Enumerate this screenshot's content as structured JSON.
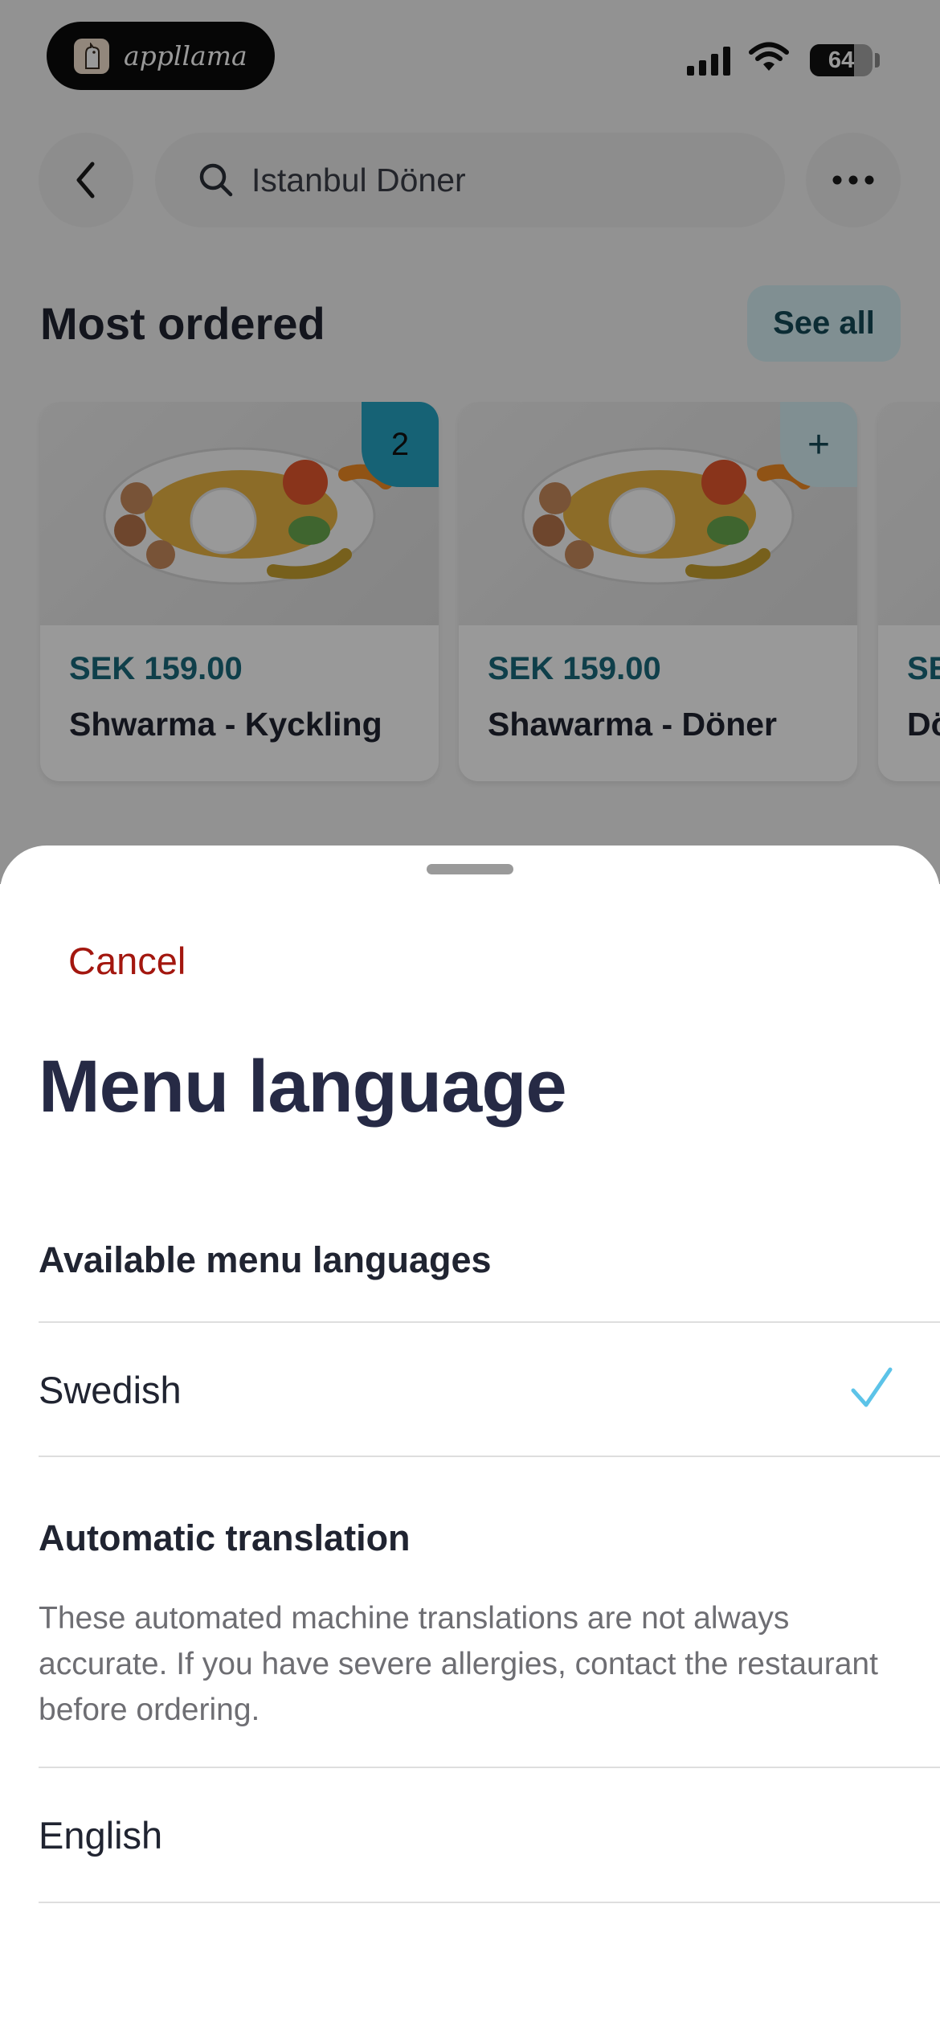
{
  "app_pill": {
    "name": "appllama"
  },
  "status": {
    "battery": "64"
  },
  "search": {
    "text": "Istanbul Döner"
  },
  "most_ordered": {
    "title": "Most ordered",
    "see_all": "See all",
    "cards": [
      {
        "price": "SEK 159.00",
        "name": "Shwarma - Kyckling",
        "badge": "2"
      },
      {
        "price": "SEK 159.00",
        "name": "Shawarma - Döner",
        "badge": "+"
      },
      {
        "price": "SE",
        "name": "Dö"
      }
    ]
  },
  "sheet": {
    "cancel": "Cancel",
    "title": "Menu language",
    "available_label": "Available menu languages",
    "languages": [
      {
        "label": "Swedish",
        "selected": true
      }
    ],
    "auto_label": "Automatic translation",
    "auto_note": "These automated machine translations are not always accurate. If you have severe allergies, contact the restaurant before ordering.",
    "auto_languages": [
      {
        "label": "English"
      }
    ]
  },
  "colors": {
    "accent": "#26a3c4",
    "cancel": "#a3170f",
    "check": "#5cc3e8",
    "title": "#262a45"
  },
  "icons": {
    "back": "chevron-left-icon",
    "search": "search-icon",
    "more": "more-horizontal-icon",
    "check": "checkmark-icon"
  }
}
